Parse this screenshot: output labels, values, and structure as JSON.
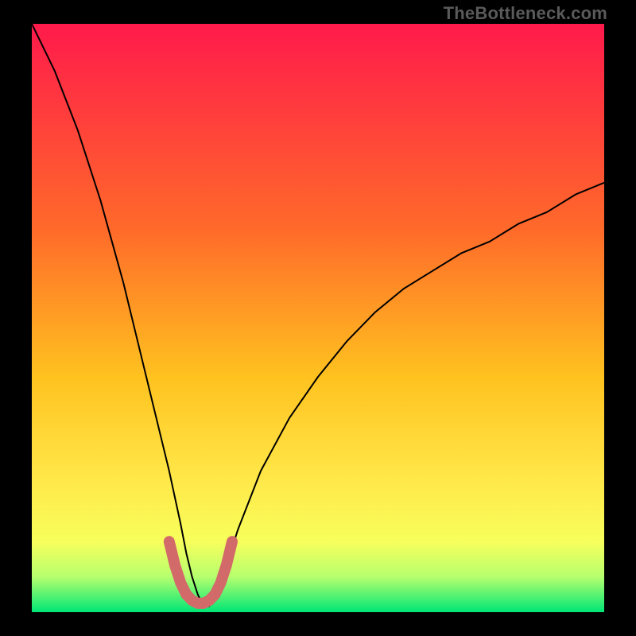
{
  "watermark": "TheBottleneck.com",
  "chart_data": {
    "type": "line",
    "title": "",
    "xlabel": "",
    "ylabel": "",
    "xlim": [
      0,
      100
    ],
    "ylim": [
      0,
      100
    ],
    "grid": false,
    "legend": false,
    "background_gradient": {
      "stops": [
        {
          "offset": 0.0,
          "color": "#ff1a4b"
        },
        {
          "offset": 0.35,
          "color": "#ff6a2a"
        },
        {
          "offset": 0.6,
          "color": "#ffc21f"
        },
        {
          "offset": 0.78,
          "color": "#ffe94a"
        },
        {
          "offset": 0.88,
          "color": "#f7ff5c"
        },
        {
          "offset": 0.94,
          "color": "#b6ff6e"
        },
        {
          "offset": 1.0,
          "color": "#00e676"
        }
      ]
    },
    "series": [
      {
        "name": "bottleneck-curve",
        "color": "#000000",
        "stroke_width": 2,
        "x": [
          0,
          2,
          4,
          6,
          8,
          10,
          12,
          14,
          16,
          18,
          20,
          22,
          24,
          26,
          27,
          28,
          29,
          30,
          31,
          32,
          34,
          36,
          40,
          45,
          50,
          55,
          60,
          65,
          70,
          75,
          80,
          85,
          90,
          95,
          100
        ],
        "y": [
          100,
          96,
          92,
          87,
          82,
          76,
          70,
          63,
          56,
          48,
          40,
          32,
          24,
          15,
          10,
          6,
          3,
          1,
          1,
          3,
          8,
          14,
          24,
          33,
          40,
          46,
          51,
          55,
          58,
          61,
          63,
          66,
          68,
          71,
          73
        ]
      },
      {
        "name": "valley-marker",
        "color": "#d36a6a",
        "stroke_width": 14,
        "linecap": "round",
        "x": [
          24,
          25,
          26,
          27,
          28,
          29,
          30,
          31,
          32,
          33,
          34,
          35
        ],
        "y": [
          12,
          8,
          5,
          3,
          2,
          1.5,
          1.5,
          2,
          3,
          5,
          8,
          12
        ]
      }
    ]
  }
}
